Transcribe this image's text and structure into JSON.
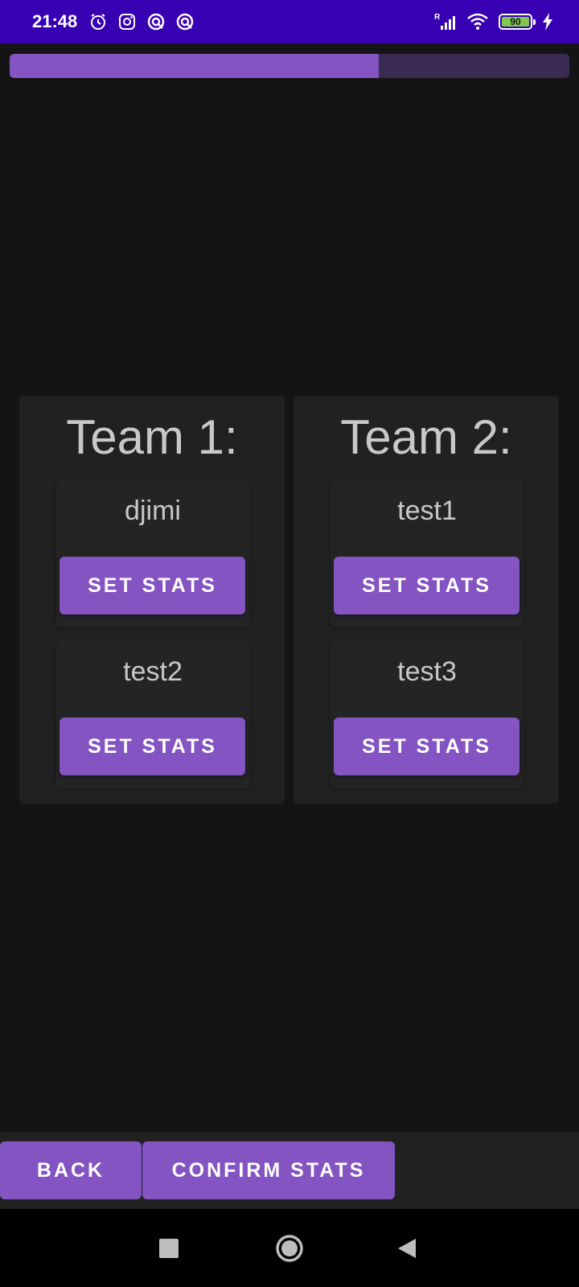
{
  "status_bar": {
    "time": "21:48",
    "left_icons": [
      "alarm-icon",
      "instagram-icon",
      "app-notification-icon",
      "app-notification-icon"
    ],
    "network_label": "R",
    "battery_level": "90",
    "charging": true
  },
  "progress": {
    "fraction": 0.66
  },
  "teams": [
    {
      "title": "Team 1:",
      "players": [
        {
          "name": "djimi",
          "button": "SET STATS"
        },
        {
          "name": "test2",
          "button": "SET STATS"
        }
      ]
    },
    {
      "title": "Team 2:",
      "players": [
        {
          "name": "test1",
          "button": "SET STATS"
        },
        {
          "name": "test3",
          "button": "SET STATS"
        }
      ]
    }
  ],
  "actions": {
    "back": "BACK",
    "confirm": "CONFIRM STATS"
  },
  "nav": {
    "icons": [
      "recents-icon",
      "home-icon",
      "back-icon"
    ]
  },
  "colors": {
    "accent": "#8454c2",
    "status_bar": "#3700b3",
    "background": "#141414",
    "card": "#212121",
    "progress_track": "#3a2b52",
    "battery": "#7ec84f"
  }
}
